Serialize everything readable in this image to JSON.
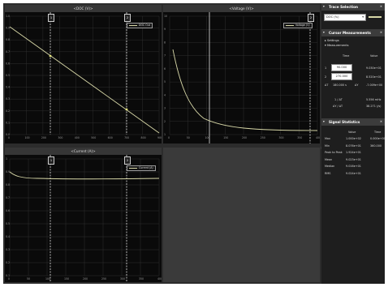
{
  "plots": {
    "top_left": {
      "title": "<DOC (V)>",
      "legend": "DOC Out",
      "cursor1": "1",
      "cursor2": "2",
      "y_ticks": [
        "1.0",
        "0.9",
        "0.8",
        "0.7",
        "0.6",
        "0.5",
        "0.4",
        "0.3",
        "0.2",
        "0.1",
        "0.0"
      ],
      "x_ticks": [
        "0",
        "100",
        "200",
        "300",
        "400",
        "500",
        "600",
        "700",
        "800",
        "900"
      ]
    },
    "top_right": {
      "title": "<Voltage (V)>",
      "legend": "Voltage (V)",
      "cursor1": "1",
      "cursor2": "2",
      "y_ticks": [
        "10",
        "9",
        "8",
        "7",
        "6",
        "5",
        "4",
        "3",
        "2",
        "1"
      ],
      "x_ticks": [
        "0",
        "50",
        "100",
        "150",
        "200",
        "250",
        "300",
        "350",
        "400"
      ]
    },
    "bottom_left": {
      "title": "<Current (A)>",
      "legend": "Current (A)",
      "cursor1": "1",
      "cursor2": "2",
      "y_ticks": [
        "1",
        "0.9",
        "0.8",
        "0.7",
        "0.6",
        "0.5",
        "0.4",
        "0.3",
        "0.2",
        "0.1"
      ],
      "x_ticks": [
        "0",
        "50",
        "100",
        "150",
        "200",
        "250",
        "300",
        "350",
        "400"
      ]
    }
  },
  "sidebar": {
    "trace_selection": {
      "header": "Trace Selection",
      "selected": "DOC (%)"
    },
    "cursor_measurements": {
      "header": "Cursor Measurements",
      "settings": "Settings",
      "measurements": "Measurements",
      "col_time": "Time",
      "col_value": "Value",
      "rows": [
        {
          "label": "1",
          "time": "90.000",
          "value": "9.030e+01"
        },
        {
          "label": "2",
          "time": "270.000",
          "value": "8.520e+01"
        },
        {
          "label": "ΔT",
          "time": "180.000 s",
          "dy_label": "ΔY",
          "value": "-7.009e+00"
        }
      ],
      "inv_dt_label": "1 / ΔT",
      "inv_dt_value": "5.556 mHz",
      "dy_dt_label": "ΔY / ΔT",
      "dy_dt_value": "38.271 (/s)"
    },
    "signal_statistics": {
      "header": "Signal Statistics",
      "col_value": "Value",
      "col_time": "Time",
      "rows": [
        {
          "label": "Max",
          "value": "1.000e+02",
          "time": "0.000e+00"
        },
        {
          "label": "Min",
          "value": "8.076e+01",
          "time": "360.000"
        },
        {
          "label": "Peak to Peak",
          "value": "1.924e+01",
          "time": ""
        },
        {
          "label": "Mean",
          "value": "9.023e+01",
          "time": ""
        },
        {
          "label": "Median",
          "value": "9.016e+01",
          "time": ""
        },
        {
          "label": "RMS",
          "value": "9.024e+01",
          "time": ""
        }
      ]
    }
  },
  "colors": {
    "trace": "#d8d8a8",
    "cursor_line": "#ffffff",
    "grid": "#2e2e2e",
    "panel_bg": "#1e1e1e",
    "header_bg": "#3c3c3c"
  }
}
